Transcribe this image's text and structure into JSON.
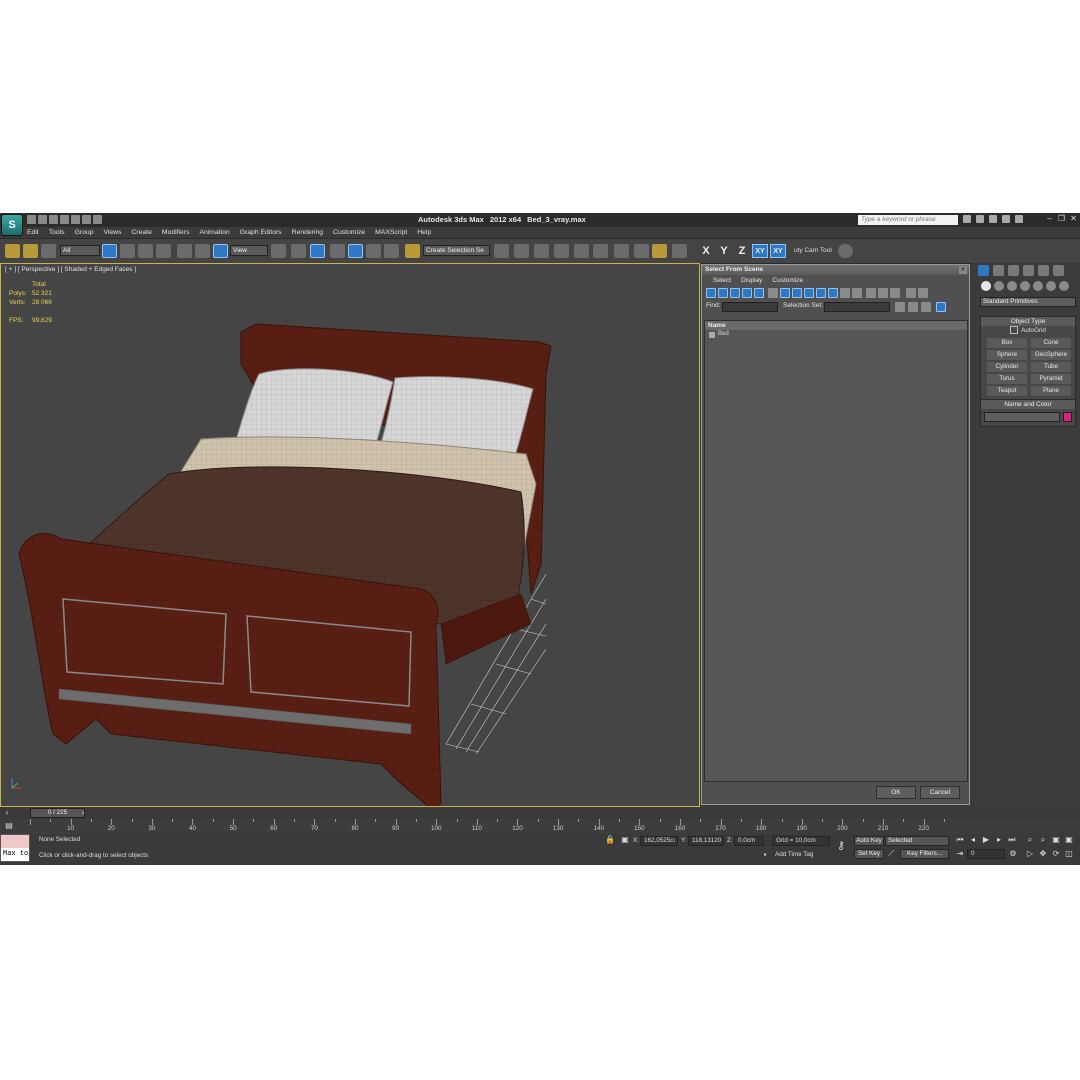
{
  "app": {
    "name": "Autodesk 3ds Max",
    "version": "2012 x64",
    "file": "Bed_3_vray.max",
    "search_placeholder": "Type a keyword or phrase"
  },
  "menu": [
    "Edit",
    "Tools",
    "Group",
    "Views",
    "Create",
    "Modifiers",
    "Animation",
    "Graph Editors",
    "Rendering",
    "Customize",
    "MAXScript",
    "Help"
  ],
  "toolbar": {
    "filter": "All",
    "coord_system": "View",
    "selection_set": "Create Selection Se",
    "axes": [
      "X",
      "Y",
      "Z",
      "XY",
      "XY"
    ],
    "cam_tool": "uty Cam Tool"
  },
  "viewport": {
    "label": "[ + ] [ Perspective ] [ Shaded + Edged Faces ]",
    "stats": {
      "total_label": "Total",
      "polys_label": "Polys:",
      "polys": "52 321",
      "verts_label": "Verts:",
      "verts": "28 066",
      "fps_label": "FPS:",
      "fps": "99,629"
    },
    "colors": {
      "frame_wood": "#5a1f14",
      "blanket": "#4e342b",
      "sheet": "#cfc3ad",
      "pillow": "#d8d8d8",
      "active_border": "#c8b449"
    }
  },
  "dialog": {
    "title": "Select From Scene",
    "menu": [
      "Select",
      "Display",
      "Customize"
    ],
    "find_label": "Find:",
    "selset_label": "Selection Set:",
    "list_header": "Name",
    "items": [
      "Bed"
    ],
    "ok": "OK",
    "cancel": "Cancel"
  },
  "command_panel": {
    "dropdown": "Standard Primitives",
    "object_type_title": "Object Type",
    "autogrid": "AutoGrid",
    "primitives": [
      "Box",
      "Cone",
      "Sphere",
      "GeoSphere",
      "Cylinder",
      "Tube",
      "Torus",
      "Pyramid",
      "Teapot",
      "Plane"
    ],
    "name_color_title": "Name and Color",
    "color": "#e0207a"
  },
  "timeline": {
    "frame": "0 / 225",
    "ticks": [
      "10",
      "20",
      "30",
      "40",
      "50",
      "60",
      "70",
      "80",
      "90",
      "100",
      "110",
      "120",
      "130",
      "140",
      "150",
      "160",
      "170",
      "180",
      "190",
      "200",
      "210",
      "220"
    ]
  },
  "status": {
    "listener": "Max to",
    "selected": "None Selected",
    "prompt": "Click or click-and-drag to select objects",
    "x_label": "X:",
    "x": "162,0525cı",
    "y_label": "Y:",
    "y": "118,13120",
    "z_label": "Z:",
    "z": "0,0cm",
    "grid": "Grid = 10,0cm",
    "add_time_tag": "Add Time Tag",
    "auto_key": "Auto Key",
    "set_key": "Set Key",
    "key_mode": "Selected",
    "key_filters": "Key Filters...",
    "current_frame": "0"
  }
}
